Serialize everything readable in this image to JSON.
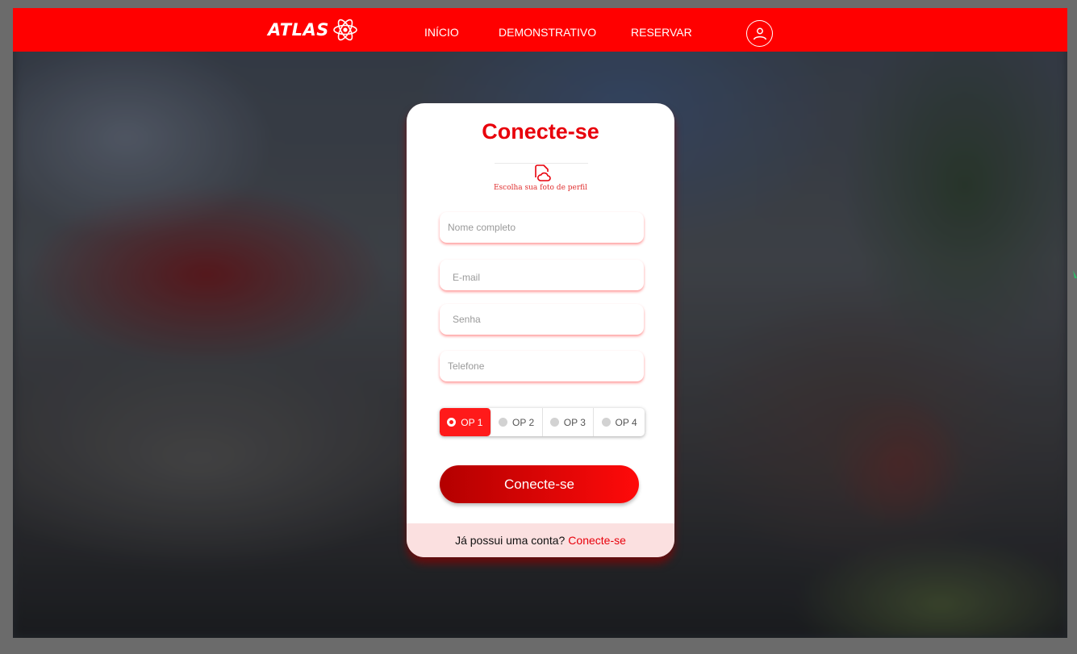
{
  "header": {
    "logo_text": "ATLAS",
    "nav": [
      {
        "label": "INÍCIO"
      },
      {
        "label": "DEMONSTRATIVO"
      },
      {
        "label": "RESERVAR"
      }
    ],
    "user_icon": "user-icon",
    "logo_icon": "atom-icon"
  },
  "card": {
    "title": "Conecte-se",
    "photo": {
      "icon": "cloud-upload-icon",
      "label": "Escolha sua foto de perfil"
    },
    "fields": {
      "name": {
        "placeholder": "Nome completo",
        "value": ""
      },
      "email": {
        "placeholder": "E-mail",
        "value": ""
      },
      "password": {
        "placeholder": "Senha",
        "value": ""
      },
      "phone": {
        "placeholder": "Telefone",
        "value": ""
      }
    },
    "options": [
      "OP 1",
      "OP 2",
      "OP 3",
      "OP 4"
    ],
    "selected_option": "OP 1",
    "submit_label": "Conecte-se",
    "footer": {
      "question": "Já possui uma conta?",
      "link": "Conecte-se"
    }
  },
  "colors": {
    "brand_red": "#ff0000",
    "title_red": "#e8000b",
    "footer_bg": "#fbe0e0"
  }
}
